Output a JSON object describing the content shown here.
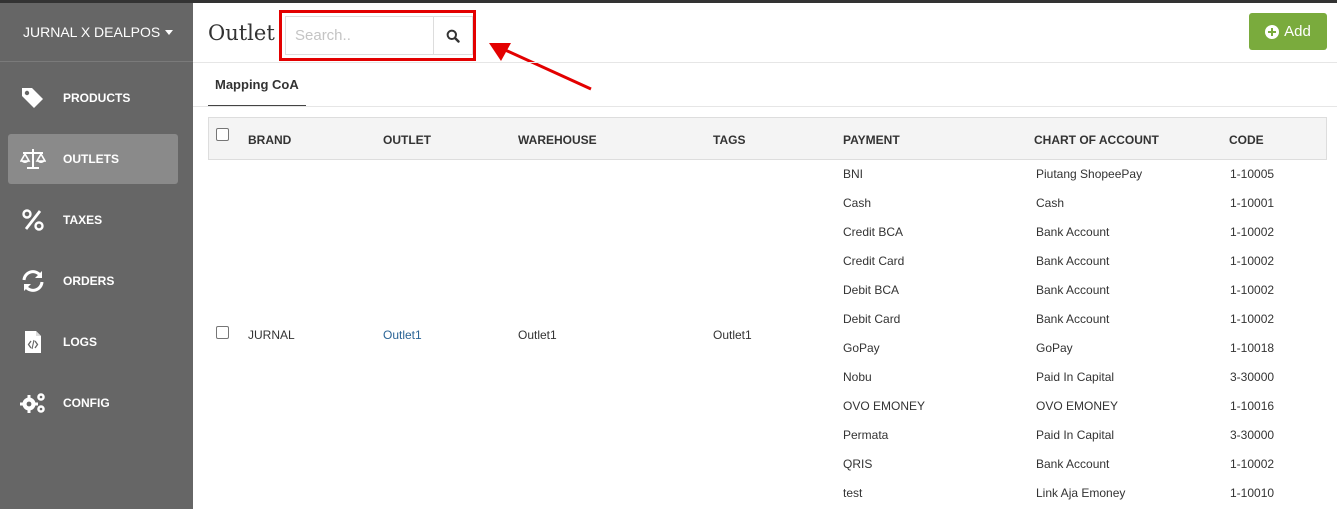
{
  "app": {
    "title": "JURNAL X DEALPOS"
  },
  "sidebar": {
    "items": [
      {
        "label": "PRODUCTS",
        "icon": "tag-icon"
      },
      {
        "label": "OUTLETS",
        "icon": "scale-icon",
        "active": true
      },
      {
        "label": "TAXES",
        "icon": "percent-icon"
      },
      {
        "label": "ORDERS",
        "icon": "refresh-icon"
      },
      {
        "label": "LOGS",
        "icon": "code-file-icon"
      },
      {
        "label": "CONFIG",
        "icon": "gears-icon"
      }
    ]
  },
  "header": {
    "title": "Outlet",
    "search": {
      "placeholder": "Search..",
      "value": ""
    },
    "add_label": "Add"
  },
  "tabs": [
    {
      "label": "Mapping CoA",
      "active": true
    }
  ],
  "table": {
    "columns": [
      "BRAND",
      "OUTLET",
      "WAREHOUSE",
      "TAGS",
      "PAYMENT",
      "CHART OF ACCOUNT",
      "CODE"
    ],
    "row": {
      "brand": "JURNAL",
      "outlet": "Outlet1",
      "warehouse": "Outlet1",
      "tags": "Outlet1",
      "payments": [
        {
          "payment": "BNI",
          "account": "Piutang ShopeePay",
          "code": "1-10005"
        },
        {
          "payment": "Cash",
          "account": "Cash",
          "code": "1-10001"
        },
        {
          "payment": "Credit BCA",
          "account": "Bank Account",
          "code": "1-10002"
        },
        {
          "payment": "Credit Card",
          "account": "Bank Account",
          "code": "1-10002"
        },
        {
          "payment": "Debit BCA",
          "account": "Bank Account",
          "code": "1-10002"
        },
        {
          "payment": "Debit Card",
          "account": "Bank Account",
          "code": "1-10002"
        },
        {
          "payment": "GoPay",
          "account": "GoPay",
          "code": "1-10018"
        },
        {
          "payment": "Nobu",
          "account": "Paid In Capital",
          "code": "3-30000"
        },
        {
          "payment": "OVO EMONEY",
          "account": "OVO EMONEY",
          "code": "1-10016"
        },
        {
          "payment": "Permata",
          "account": "Paid In Capital",
          "code": "3-30000"
        },
        {
          "payment": "QRIS",
          "account": "Bank Account",
          "code": "1-10002"
        },
        {
          "payment": "test",
          "account": "Link Aja Emoney",
          "code": "1-10010"
        }
      ]
    }
  },
  "colors": {
    "sidebar": "#666666",
    "sidebar_active": "#8a8a8a",
    "accent": "#7aab3d",
    "highlight": "#e30000",
    "link": "#2a6496"
  }
}
